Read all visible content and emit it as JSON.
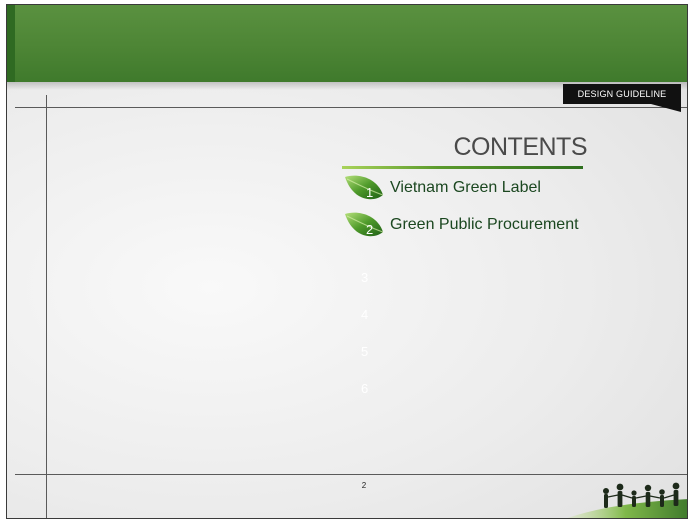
{
  "tag": {
    "label": "DESIGN GUIDELINE"
  },
  "contents": {
    "title": "CONTENTS",
    "items": [
      {
        "number": "1",
        "label": "Vietnam Green Label"
      },
      {
        "number": "2",
        "label": "Green Public Procurement"
      }
    ],
    "empty_numbers": [
      "3",
      "4",
      "5",
      "6"
    ]
  },
  "footer": {
    "page_number": "2"
  },
  "colors": {
    "header_green": "#4d8535",
    "title_text": "#4a4a4a",
    "item_text": "#1b4720"
  }
}
